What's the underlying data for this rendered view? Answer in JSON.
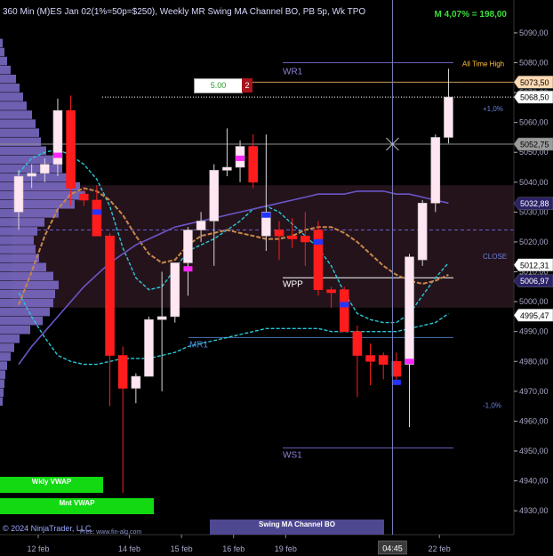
{
  "header": {
    "title": "360 Min (M)ES Jan 02(1%=50p=$250), Weekly MR Swing MA Channel BO, PB 5p, Wk TPO",
    "performance": "M 4,07% = 198,00"
  },
  "order": {
    "price": "5.00",
    "quantity": "2"
  },
  "buttons": {
    "weekly_vwap": "Wkly VWAP",
    "monthly_vwap": "Mnt VWAP"
  },
  "indicator_bar": "Swing MA Channel BO",
  "footer": {
    "copyright": "© 2024 NinjaTrader, LLC",
    "site": "Free: www.fin-alg.com"
  },
  "crosshair_time": "04:45",
  "annotations": {
    "all_time_high": "All Time High",
    "pct_plus": "+1,0%",
    "pct_minus": "-1,0%",
    "close": "CLOSE",
    "wr1": "WR1",
    "ws1": "WS1",
    "mr1": "MR1",
    "wpp": "WPP"
  },
  "price_badges": [
    {
      "text": "5073,50",
      "price": 5073.5,
      "bg": "#ffd9b3",
      "fg": "#000000"
    },
    {
      "text": "5068,50",
      "price": 5068.5,
      "bg": "#ffffff",
      "fg": "#000000"
    },
    {
      "text": "5052,75",
      "price": 5052.75,
      "bg": "#9a9a9a",
      "fg": "#000000"
    },
    {
      "text": "5032,88",
      "price": 5032.88,
      "bg": "#2b2266",
      "fg": "#ffffff"
    },
    {
      "text": "5012,31",
      "price": 5012.31,
      "bg": "#ffffff",
      "fg": "#000000"
    },
    {
      "text": "5006,97",
      "price": 5006.97,
      "bg": "#2b2266",
      "fg": "#ffffff"
    },
    {
      "text": "4995,47",
      "price": 4995.47,
      "bg": "#ffffff",
      "fg": "#000000"
    }
  ],
  "colors": {
    "bull": "#ffe6f2",
    "bear": "#ff1c1c",
    "channel": "#28c8d8",
    "ma_orange": "#c8884a",
    "ma_purple": "#6a55c8",
    "profile": "#7b69c4",
    "zone": "#2a1620",
    "green_btn": "#12d912"
  },
  "chart_data": {
    "type": "candlestick",
    "y_ticks": [
      4930,
      4940,
      4950,
      4960,
      4970,
      4980,
      4990,
      5000,
      5010,
      5020,
      5030,
      5040,
      5050,
      5060,
      5070,
      5080,
      5090
    ],
    "y_tick_labels": [
      "4930,00",
      "4940,00",
      "4950,00",
      "4960,00",
      "4970,00",
      "4980,00",
      "4990,00",
      "5000,00",
      "5010,00",
      "5020,00",
      "5030,00",
      "5040,00",
      "5050,00",
      "5060,00",
      "5070,00",
      "5080,00",
      "5090,00"
    ],
    "ylim": [
      4922,
      5101
    ],
    "x_labels": [
      {
        "text": "12 feb",
        "bar": 1.5
      },
      {
        "text": "14 feb",
        "bar": 8.5
      },
      {
        "text": "15 feb",
        "bar": 12.5
      },
      {
        "text": "16 feb",
        "bar": 16.5
      },
      {
        "text": "19 feb",
        "bar": 20.5
      },
      {
        "text": "22 feb",
        "bar": 32.3
      }
    ],
    "levels": {
      "wr1": 5080,
      "ws1": 4951,
      "mr1": 4988,
      "wpp": 5008,
      "ath": 5073.5,
      "last": 5068.5,
      "pivot_line": 5052.75,
      "dashed": 5024
    },
    "zone": [
      4998,
      5039
    ],
    "crosshair": {
      "bar": 28.7,
      "price": 5052.75
    },
    "candles": [
      {
        "o": 5030,
        "h": 5044,
        "l": 5024,
        "c": 5042
      },
      {
        "o": 5042,
        "h": 5046,
        "l": 5038,
        "c": 5043
      },
      {
        "o": 5043,
        "h": 5048,
        "l": 5040,
        "c": 5046
      },
      {
        "o": 5046,
        "h": 5068,
        "l": 5042,
        "c": 5064
      },
      {
        "o": 5064,
        "h": 5069,
        "l": 5032,
        "c": 5038
      },
      {
        "o": 5036,
        "h": 5038,
        "l": 5032,
        "c": 5034
      },
      {
        "o": 5034,
        "h": 5039,
        "l": 5022,
        "c": 5022
      },
      {
        "o": 5022,
        "h": 5023,
        "l": 4965,
        "c": 4982
      },
      {
        "o": 4982,
        "h": 4985,
        "l": 4936,
        "c": 4971
      },
      {
        "o": 4971,
        "h": 4976,
        "l": 4966,
        "c": 4975
      },
      {
        "o": 4975,
        "h": 4995,
        "l": 4975,
        "c": 4994
      },
      {
        "o": 4994,
        "h": 5010,
        "l": 4970,
        "c": 4995
      },
      {
        "o": 4995,
        "h": 5012,
        "l": 4993,
        "c": 5013
      },
      {
        "o": 5013,
        "h": 5025,
        "l": 5002,
        "c": 5024
      },
      {
        "o": 5024,
        "h": 5030,
        "l": 5020,
        "c": 5027
      },
      {
        "o": 5027,
        "h": 5046,
        "l": 5012,
        "c": 5044
      },
      {
        "o": 5044,
        "h": 5058,
        "l": 5042,
        "c": 5045
      },
      {
        "o": 5045,
        "h": 5054,
        "l": 5040,
        "c": 5052
      },
      {
        "o": 5052,
        "h": 5056,
        "l": 5038,
        "c": 5040
      },
      {
        "o": 5022,
        "h": 5056,
        "l": 5017,
        "c": 5030
      },
      {
        "o": 5024,
        "h": 5027,
        "l": 5014,
        "c": 5022
      },
      {
        "o": 5022,
        "h": 5028,
        "l": 5018,
        "c": 5021
      },
      {
        "o": 5022,
        "h": 5030,
        "l": 5012,
        "c": 5020
      },
      {
        "o": 5024,
        "h": 5027,
        "l": 5002,
        "c": 5004
      },
      {
        "o": 5004,
        "h": 5005,
        "l": 4998,
        "c": 5003
      },
      {
        "o": 5004,
        "h": 5005,
        "l": 4990,
        "c": 4990
      },
      {
        "o": 4990,
        "h": 4992,
        "l": 4968,
        "c": 4982
      },
      {
        "o": 4982,
        "h": 4986,
        "l": 4972,
        "c": 4980
      },
      {
        "o": 4982,
        "h": 4983,
        "l": 4974,
        "c": 4979
      },
      {
        "o": 4980,
        "h": 4983,
        "l": 4972,
        "c": 4975
      },
      {
        "o": 4979,
        "h": 5016,
        "l": 4958,
        "c": 5015
      },
      {
        "o": 5014,
        "h": 5034,
        "l": 5012,
        "c": 5033
      },
      {
        "o": 5033,
        "h": 5056,
        "l": 5030,
        "c": 5055
      },
      {
        "o": 5055,
        "h": 5078,
        "l": 5053,
        "c": 5068.5
      }
    ],
    "markers": [
      {
        "bar": 3,
        "price": 5049,
        "color": "#ff27ff"
      },
      {
        "bar": 6,
        "price": 5030,
        "color": "#2435ff"
      },
      {
        "bar": 13,
        "price": 5011,
        "color": "#ff27ff"
      },
      {
        "bar": 17,
        "price": 5048,
        "color": "#ff27ff"
      },
      {
        "bar": 19,
        "price": 5029,
        "color": "#2435ff"
      },
      {
        "bar": 23,
        "price": 5020,
        "color": "#2435ff"
      },
      {
        "bar": 25,
        "price": 4999,
        "color": "#2435ff"
      },
      {
        "bar": 29,
        "price": 4973,
        "color": "#2435ff"
      },
      {
        "bar": 30,
        "price": 4980,
        "color": "#ff27ff"
      }
    ],
    "series": [
      {
        "name": "",
        "role": "channel_upper",
        "values": [
          5043,
          5048,
          5050,
          5051,
          5049,
          5046,
          5041,
          5032,
          5018,
          5008,
          5004,
          5005,
          5011,
          5017,
          5019,
          5021,
          5024,
          5027,
          5031,
          5032,
          5030,
          5026,
          5022,
          5018,
          5012,
          5003,
          4996,
          4994,
          4993,
          4993,
          4996,
          5002,
          5008,
          5013
        ]
      },
      {
        "name": "",
        "role": "channel_lower",
        "values": [
          5003,
          4995,
          4988,
          4982,
          4980,
          4979,
          4979,
          4980,
          4981,
          4981,
          4981,
          4982,
          4983,
          4985,
          4986,
          4987,
          4988,
          4989,
          4990,
          4991,
          4991,
          4991,
          4991,
          4991,
          4990,
          4990,
          4990,
          4990,
          4990,
          4990,
          4991,
          4992,
          4993,
          4996
        ]
      },
      {
        "name": "",
        "role": "ma_orange",
        "values": [
          4999,
          5010,
          5022,
          5031,
          5036,
          5038,
          5037,
          5034,
          5029,
          5022,
          5016,
          5013,
          5014,
          5019,
          5022,
          5023,
          5024,
          5023,
          5022,
          5021,
          5021,
          5022,
          5024,
          5025,
          5025,
          5023,
          5020,
          5016,
          5012,
          5009,
          5007,
          5006,
          5007,
          5009
        ]
      },
      {
        "name": "",
        "role": "ma_purple",
        "values": [
          4979,
          4985,
          4990,
          4995,
          5000,
          5005,
          5009,
          5013,
          5016,
          5019,
          5021,
          5023,
          5025,
          5026,
          5027,
          5028,
          5029,
          5030,
          5031,
          5032,
          5033,
          5034,
          5035,
          5036,
          5036,
          5036,
          5037,
          5037,
          5037,
          5036,
          5036,
          5035,
          5034,
          5033
        ]
      }
    ],
    "profile": {
      "y_start": 4965,
      "y_step": 3,
      "widths": [
        3,
        4,
        5,
        6,
        8,
        12,
        16,
        22,
        34,
        48,
        56,
        60,
        62,
        66,
        60,
        52,
        44,
        40,
        38,
        42,
        50,
        66,
        84,
        96,
        90,
        80,
        70,
        60,
        52,
        46,
        44,
        40,
        36,
        30,
        26,
        22,
        18,
        12,
        8,
        5,
        3
      ]
    }
  }
}
